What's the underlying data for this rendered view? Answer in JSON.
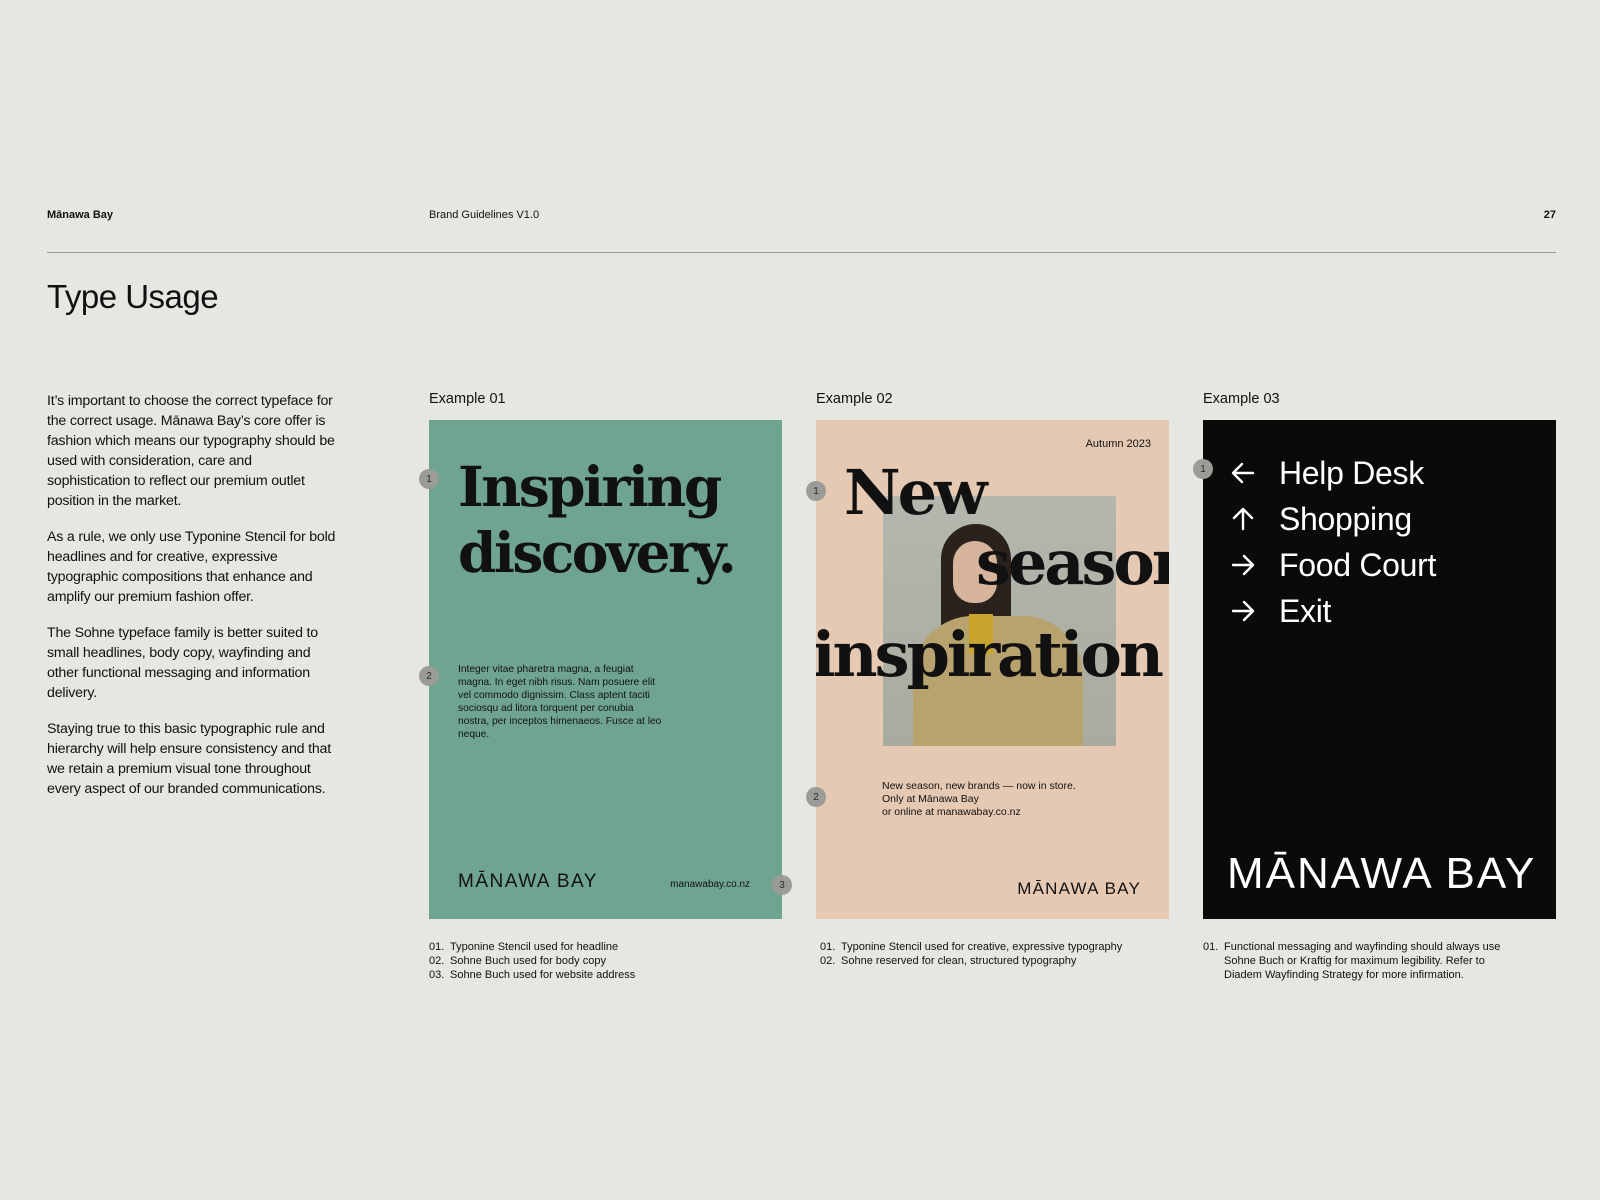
{
  "header": {
    "brand": "Mānawa Bay",
    "document": "Brand Guidelines V1.0",
    "page_number": "27"
  },
  "title": "Type Usage",
  "intro": [
    "It’s important to choose the correct typeface for the correct usage. Mānawa Bay’s core offer is fashion which means our typography should be used with consideration, care and sophistication to reflect our premium outlet position in the market.",
    "As a rule, we only use Typonine Stencil for bold headlines and for creative, expressive typographic compositions that enhance and amplify our premium fashion offer.",
    "The Sohne typeface family is better suited to small headlines, body copy, wayfinding and other functional messaging and information delivery.",
    "Staying true to this basic typographic rule and hierarchy will help ensure consistency and that we retain a premium visual tone throughout every aspect of our branded communications."
  ],
  "example1": {
    "label": "Example 01",
    "headline_line1": "Inspiring",
    "headline_line2": "discovery.",
    "body": "Integer vitae pharetra magna, a feugiat magna. In eget nibh risus. Nam posuere elit vel commodo dignissim. Class aptent taciti sociosqu ad litora torquent per conubia nostra, per inceptos himenaeos. Fusce at leo neque.",
    "logo": "MĀNAWA BAY",
    "url": "manawabay.co.nz",
    "markers": [
      "1",
      "2",
      "3"
    ],
    "notes": [
      {
        "num": "01.",
        "text": "Typonine Stencil used for headline"
      },
      {
        "num": "02.",
        "text": "Sohne Buch used for body copy"
      },
      {
        "num": "03.",
        "text": "Sohne Buch used for website address"
      }
    ],
    "color": "#6fa590"
  },
  "example2": {
    "label": "Example 02",
    "date": "Autumn 2023",
    "word1": "New",
    "word2": "season",
    "word3": "inspiration",
    "body_line1": "New season, new brands — now in store.",
    "body_line2": "Only at Mānawa Bay",
    "body_line3": "or online at manawabay.co.nz",
    "logo": "MĀNAWA BAY",
    "markers": [
      "1",
      "2"
    ],
    "notes": [
      {
        "num": "01.",
        "text": "Typonine Stencil used for creative, expressive typography"
      },
      {
        "num": "02.",
        "text": "Sohne reserved for clean, structured typography"
      }
    ],
    "color": "#e6c9b3"
  },
  "example3": {
    "label": "Example 03",
    "wayfinding": [
      {
        "icon": "arrow-left-icon",
        "label": "Help Desk"
      },
      {
        "icon": "arrow-up-icon",
        "label": "Shopping"
      },
      {
        "icon": "arrow-right-icon",
        "label": "Food Court"
      },
      {
        "icon": "arrow-right-icon",
        "label": "Exit"
      }
    ],
    "logo": "MĀNAWA BAY",
    "markers": [
      "1"
    ],
    "notes": [
      {
        "num": "01.",
        "text": "Functional messaging and wayfinding should always use Sohne Buch or Kraftig for maximum legibility. Refer to Diadem Wayfinding Strategy for more infirmation."
      }
    ],
    "color": "#0a0a08"
  }
}
